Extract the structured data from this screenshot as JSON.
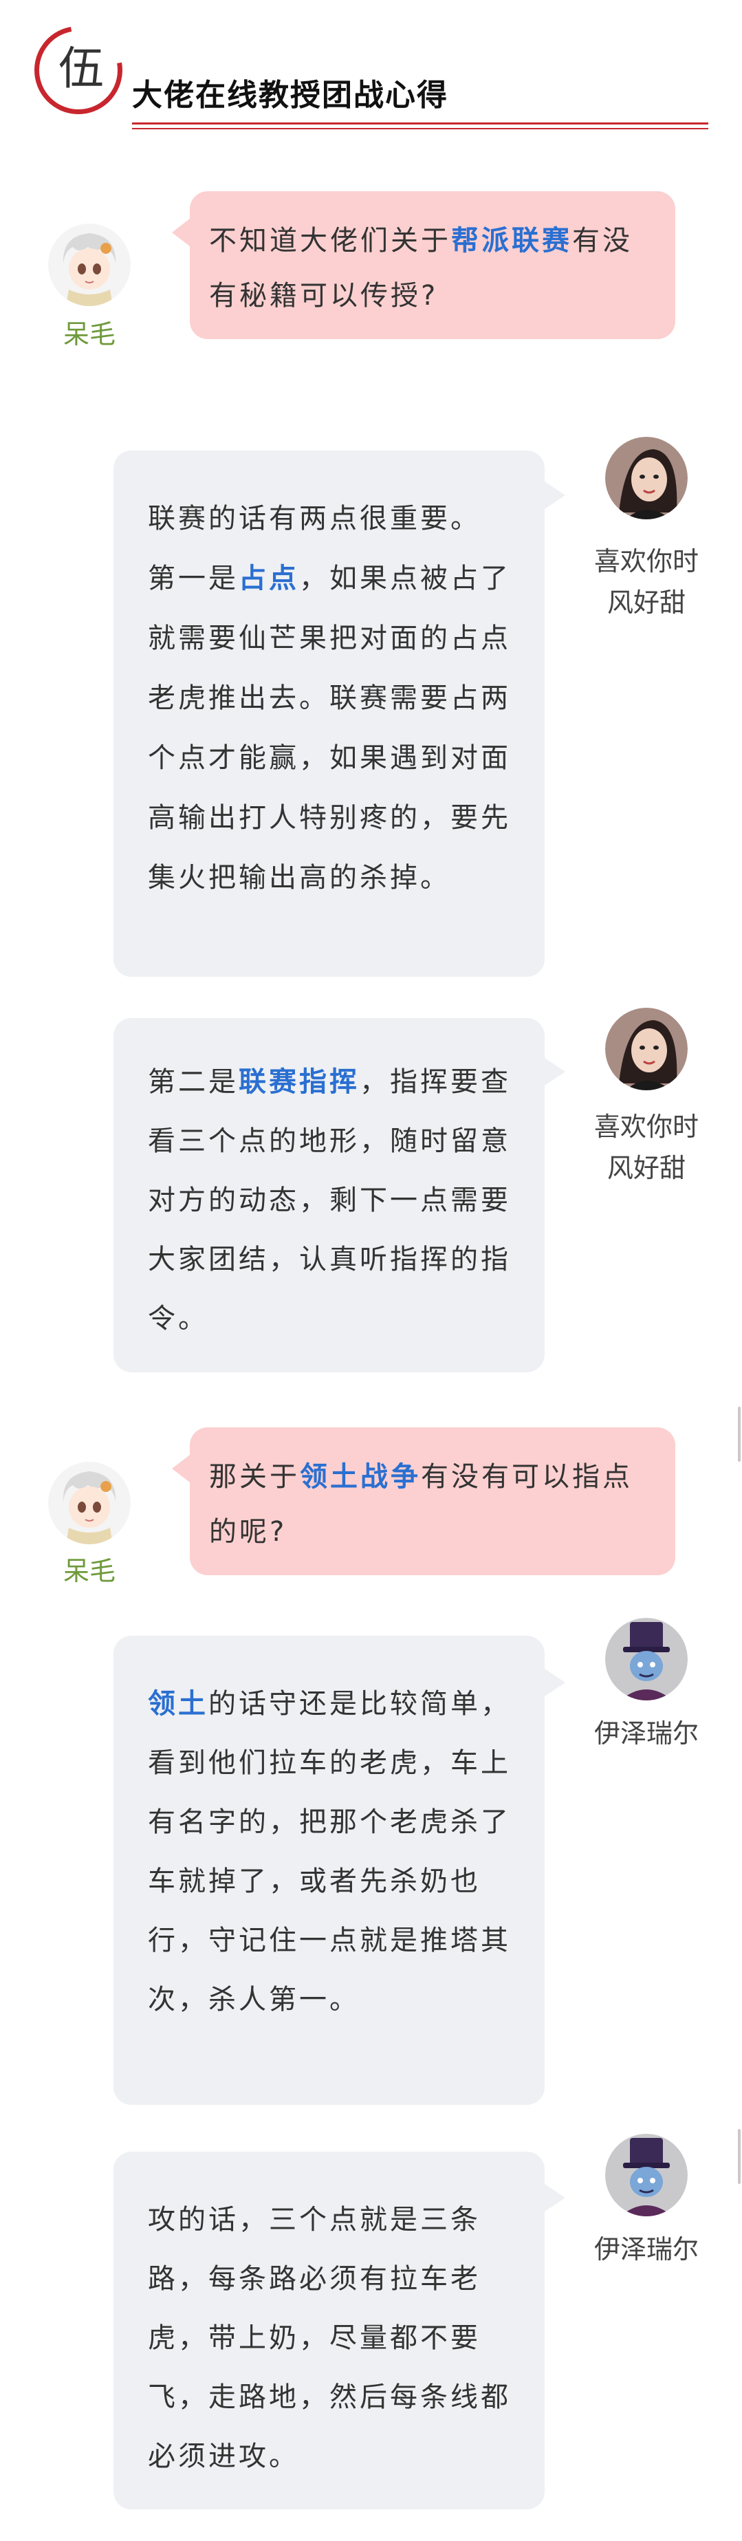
{
  "header": {
    "number_char": "伍",
    "title": "大佬在线教授团战心得"
  },
  "users": {
    "asker": {
      "name": "呆毛",
      "avatar_icon": "chibi-white-hair-avatar"
    },
    "girl": {
      "name_line1": "喜欢你时",
      "name_line2": "风好甜",
      "avatar_icon": "girl-photo-avatar"
    },
    "ezreal": {
      "name": "伊泽瑞尔",
      "avatar_icon": "top-hat-character-avatar"
    }
  },
  "messages": {
    "q1": {
      "pre": "不知道大佬们关于",
      "hl": "帮派联赛",
      "post": "有没有秘籍可以传授?"
    },
    "a1": {
      "l1": "联赛的话有两点很重要。",
      "pre": "第一是",
      "hl": "占点",
      "post": "，如果点被占了就需要仙芒果把对面的占点老虎推出去。联赛需要占两个点才能赢，如果遇到对面高输出打人特别疼的，要先集火把输出高的杀掉。"
    },
    "a2": {
      "pre": "第二是",
      "hl": "联赛指挥",
      "post": "，指挥要查看三个点的地形，随时留意对方的动态，剩下一点需要大家团结，认真听指挥的指令。"
    },
    "q2": {
      "pre": "那关于",
      "hl": "领土战争",
      "post": "有没有可以指点的呢?"
    },
    "a3": {
      "hl": "领土",
      "post": "的话守还是比较简单，看到他们拉车的老虎，车上有名字的，把那个老虎杀了车就掉了，或者先杀奶也行，守记住一点就是推塔其次，杀人第一。"
    },
    "a4": {
      "text": "攻的话，三个点就是三条路，每条路必须有拉车老虎，带上奶，尽量都不要飞，走路地，然后每条线都必须进攻。"
    }
  },
  "colors": {
    "accent_red": "#c8262e",
    "highlight_blue": "#2a6fd1",
    "pink_bubble": "#fcd0d0",
    "gray_bubble": "#eef0f3",
    "name_green": "#6e9a3c"
  }
}
